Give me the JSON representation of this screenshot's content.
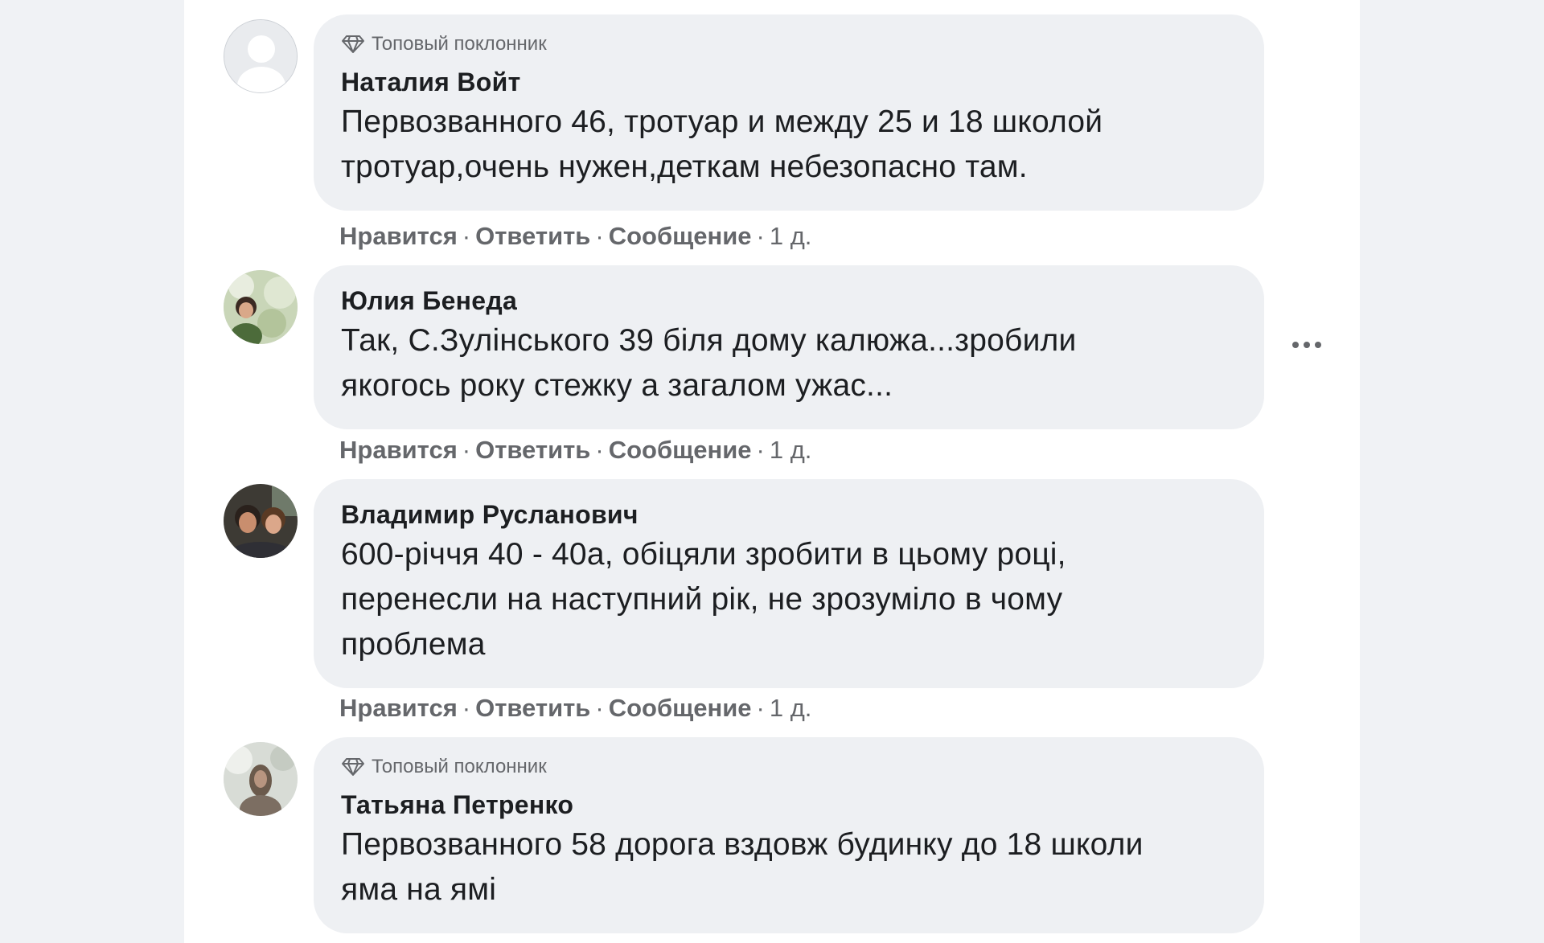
{
  "comments": [
    {
      "badge": "Топовый поклонник",
      "author": "Наталия Войт",
      "text": "Первозванного 46, тротуар и между 25 и 18 школой тротуар,очень нужен,деткам небезопасно там.",
      "actions": {
        "like": "Нравится",
        "reply": "Ответить",
        "message": "Сообщение",
        "sep": "·",
        "time": "1 д."
      },
      "avatar": "default-avatar"
    },
    {
      "author": "Юлия Бенеда",
      "text": "Так, С.Зулінського 39 біля дому калюжа...зробили якогось року стежку а загалом ужас...",
      "actions": {
        "like": "Нравится",
        "reply": "Ответить",
        "message": "Сообщение",
        "sep": "·",
        "time": "1 д."
      },
      "avatar": "photo-avatar"
    },
    {
      "author": "Владимир Русланович",
      "text": "600-річчя 40 - 40а, обіцяли зробити в цьому році, перенесли на наступний рік, не зрозуміло в чому проблема",
      "actions": {
        "like": "Нравится",
        "reply": "Ответить",
        "message": "Сообщение",
        "sep": "·",
        "time": "1 д."
      },
      "avatar": "photo-avatar"
    },
    {
      "badge": "Топовый поклонник",
      "author": "Татьяна Петренко",
      "text": "Первозванного 58 дорога вздовж будинку до 18 школи яма на ямі",
      "avatar": "photo-avatar"
    }
  ],
  "icons": {
    "badge": "diamond-icon",
    "more": "more-dots-icon"
  },
  "colors": {
    "page_bg": "#f0f2f5",
    "bubble_bg": "#eef0f3",
    "text": "#1c1e21",
    "secondary": "#65676b"
  }
}
